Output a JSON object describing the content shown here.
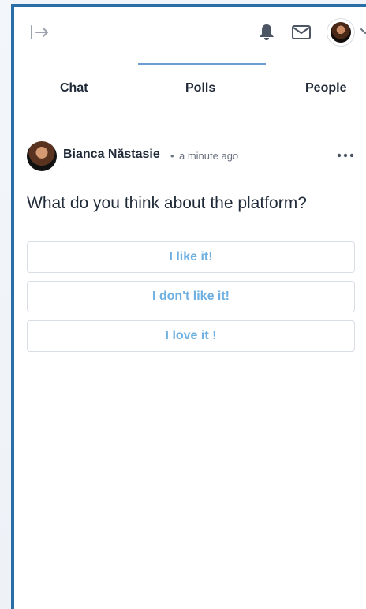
{
  "header": {
    "icons": {
      "collapse": "arrow-right-to-bar-icon",
      "notifications": "bell-icon",
      "messages": "mail-icon",
      "avatar": "user-avatar",
      "menu": "chevron-down-icon"
    }
  },
  "tabs": [
    {
      "label": "Chat"
    },
    {
      "label": "Polls",
      "active": true
    },
    {
      "label": "People"
    }
  ],
  "poll": {
    "author": "Bianca Năstasie",
    "separator": "•",
    "time": "a minute ago",
    "question": "What do you think about the platform?",
    "options": [
      {
        "label": "I like it!"
      },
      {
        "label": "I don't like it!"
      },
      {
        "label": "I love it !"
      }
    ]
  },
  "colors": {
    "accent": "#2a6ea8",
    "tab_indicator": "#6a9dd0",
    "option_text": "#6fb0e0",
    "text_primary": "#1f2937",
    "text_muted": "#6b7280"
  }
}
